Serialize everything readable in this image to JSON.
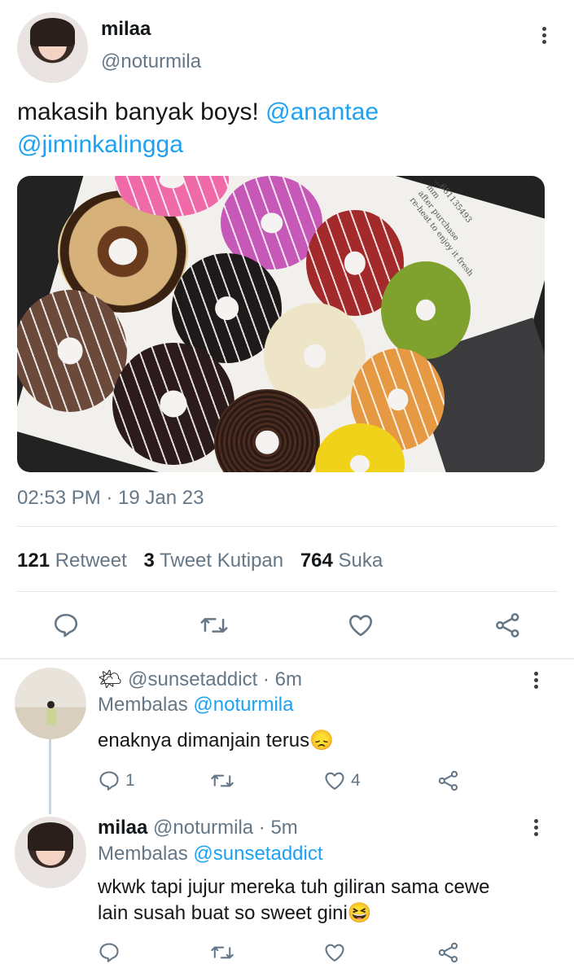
{
  "tweet": {
    "display_name": "milaa",
    "handle": "@noturmila",
    "text_plain": "makasih banyak boys!",
    "mention_1": "@anantae",
    "mention_2": "@jiminkalingga",
    "timestamp": "02:53 PM · 19 Jan 23",
    "photo_text": "...681135493\nmm\nafter purchase\nre-heat to enjoy it fresh"
  },
  "stats": {
    "retweets_count": "121",
    "retweets_label": "Retweet",
    "quotes_count": "3",
    "quotes_label": "Tweet Kutipan",
    "likes_count": "764",
    "likes_label": "Suka"
  },
  "replies": [
    {
      "emoji": "🌤",
      "handle": "@sunsetaddict",
      "time": " · 6m",
      "replying_label": "Membalas",
      "replying_to": "@noturmila",
      "text": "enaknya dimanjain terus",
      "text_emoji": "😞",
      "reply_count": "1",
      "like_count": "4"
    },
    {
      "display_name": "milaa",
      "handle": "@noturmila",
      "time": " · 5m",
      "replying_label": "Membalas",
      "replying_to": "@sunsetaddict",
      "text_line1": "wkwk tapi jujur mereka tuh giliran sama cewe",
      "text_line2": "lain susah buat so sweet gini",
      "text_emoji": "😆"
    }
  ],
  "icons": {
    "reply": "reply-icon",
    "retweet": "retweet-icon",
    "like": "heart-icon",
    "share": "share-icon",
    "more": "more-vertical-icon"
  },
  "colors": {
    "link": "#1da1f2",
    "muted": "#657786",
    "text": "#14171a",
    "divider": "#e1e8ed"
  }
}
